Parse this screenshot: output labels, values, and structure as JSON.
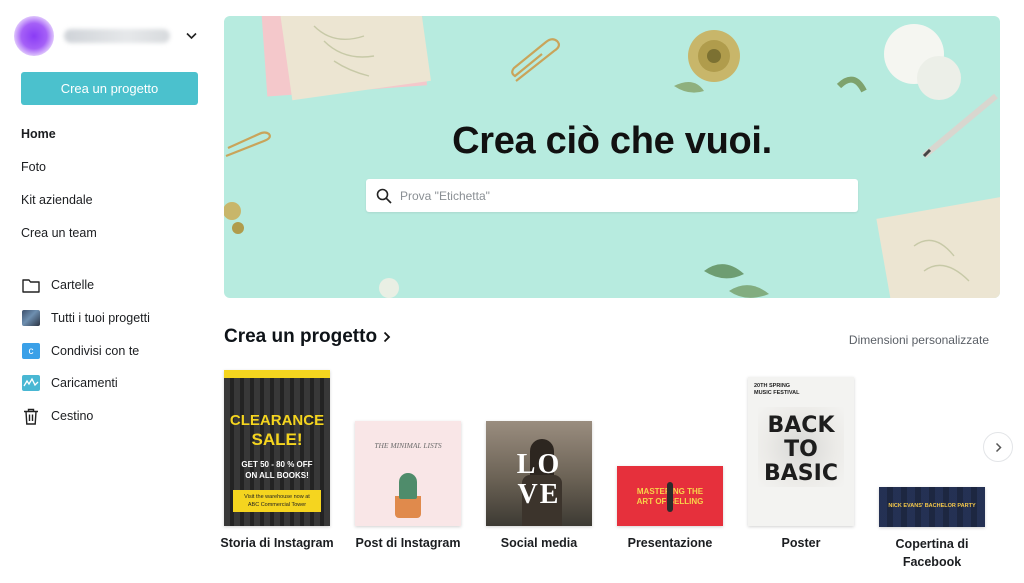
{
  "sidebar": {
    "account_chevron_icon": "chevron-down-icon",
    "create_button_label": "Crea un progetto",
    "nav": [
      {
        "label": "Home",
        "active": true
      },
      {
        "label": "Foto"
      },
      {
        "label": "Kit aziendale"
      },
      {
        "label": "Crea un team"
      }
    ],
    "folders": [
      {
        "label": "Cartelle",
        "icon": "folder-icon"
      },
      {
        "label": "Tutti i tuoi progetti",
        "icon": "projects-thumbnail-icon"
      },
      {
        "label": "Condivisi con te",
        "icon": "shared-icon",
        "icon_letter": "c"
      },
      {
        "label": "Caricamenti",
        "icon": "uploads-icon"
      },
      {
        "label": "Cestino",
        "icon": "trash-icon"
      }
    ]
  },
  "hero": {
    "title": "Crea ciò che vuoi.",
    "search_placeholder": "Prova \"Etichetta\"",
    "background_color": "#b7ebdf"
  },
  "section": {
    "title": "Crea un progetto",
    "custom_dimensions_label": "Dimensioni personalizzate"
  },
  "templates": [
    {
      "label": "Storia di Instagram",
      "thumb": {
        "line1": "CLEARANCE",
        "line2": "SALE!",
        "line3": "GET 50 - 80 % OFF",
        "line4": "ON ALL BOOKS!",
        "line5": "Visit the warehouse now at",
        "line6": "ABC Commercial Tower"
      }
    },
    {
      "label": "Post di Instagram",
      "thumb": {
        "line1": "THE MINIMAL LISTS"
      }
    },
    {
      "label": "Social media",
      "thumb": {
        "line1": "LO",
        "line2": "VE"
      }
    },
    {
      "label": "Presentazione",
      "thumb": {
        "line1": "MASTERING THE",
        "line2": "ART OF SELLING"
      }
    },
    {
      "label": "Poster",
      "thumb": {
        "line1": "20TH SPRING",
        "line2": "MUSIC FESTIVAL",
        "line3": "BACK",
        "line4": "TO",
        "line5": "BASIC"
      }
    },
    {
      "label": "Copertina di Facebook",
      "thumb": {
        "line1": "NICK EVANS' BACHELOR PARTY"
      }
    }
  ],
  "next_icon": "chevron-right-icon",
  "colors": {
    "accent": "#4bc1cd",
    "avatar": "#8a3cf5"
  }
}
